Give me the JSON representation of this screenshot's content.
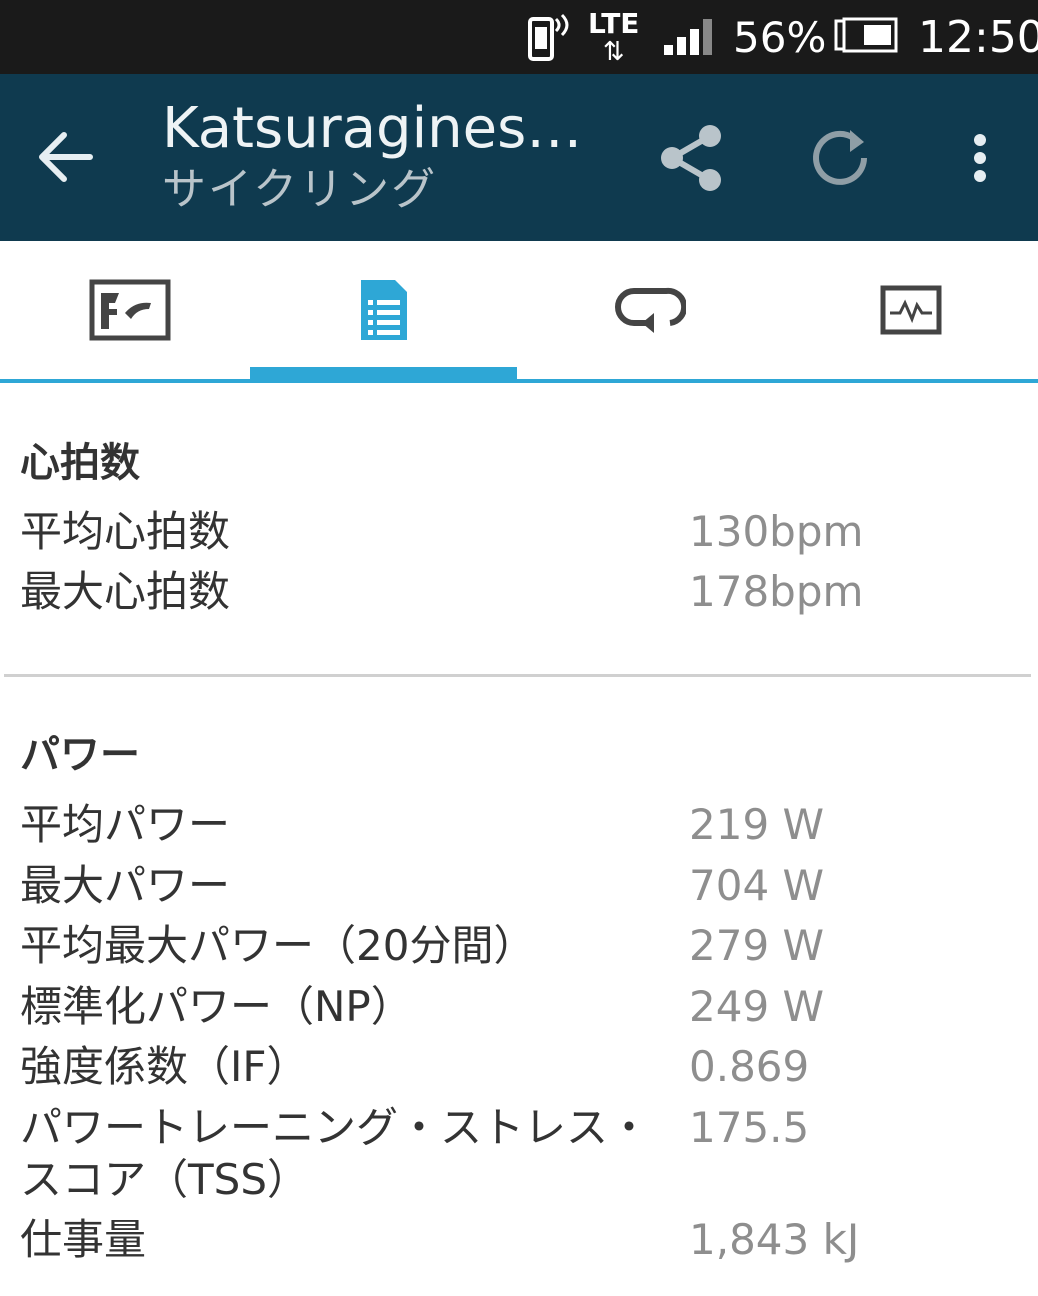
{
  "status_bar": {
    "network": "LTE",
    "battery": "56%",
    "time": "12:50"
  },
  "app_bar": {
    "title": "Katsuraginesa...",
    "subtitle": "サイクリング",
    "color": "#0f3a4f"
  },
  "tabs": [
    {
      "icon": "map-icon"
    },
    {
      "icon": "list-document-icon"
    },
    {
      "icon": "laps-icon"
    },
    {
      "icon": "chart-icon"
    }
  ],
  "selected_tab": 1,
  "accent_color": "#2ea7d6",
  "heart_rate": {
    "title": "心拍数",
    "rows": [
      {
        "label": "平均心拍数",
        "value": "130bpm"
      },
      {
        "label": "最大心拍数",
        "value": "178bpm"
      }
    ]
  },
  "power": {
    "title": "パワー",
    "rows": [
      {
        "label": "平均パワー",
        "value": "219 W"
      },
      {
        "label": "最大パワー",
        "value": "704 W"
      },
      {
        "label": "平均最大パワー（20分間）",
        "value": "279 W"
      },
      {
        "label": "標準化パワー（NP）",
        "value": "249 W"
      },
      {
        "label": "強度係数（IF）",
        "value": "0.869"
      },
      {
        "label": "パワートレーニング・ストレス・",
        "label_line2": "スコア（TSS）",
        "value": "175.5"
      },
      {
        "label": "仕事量",
        "value": "1,843 kJ"
      }
    ]
  }
}
